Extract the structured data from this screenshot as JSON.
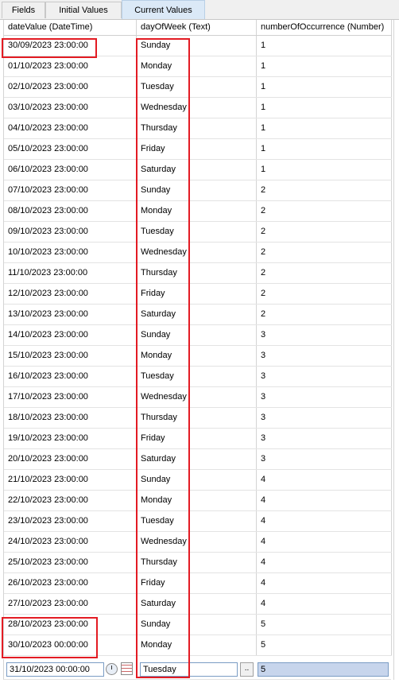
{
  "tabs": [
    "Fields",
    "Initial Values",
    "Current Values"
  ],
  "columns": [
    "dateValue  (DateTime)",
    "dayOfWeek  (Text)",
    "numberOfOccurrence  (Number)"
  ],
  "rows": [
    [
      "30/09/2023 23:00:00",
      "Sunday",
      "1"
    ],
    [
      "01/10/2023 23:00:00",
      "Monday",
      "1"
    ],
    [
      "02/10/2023 23:00:00",
      "Tuesday",
      "1"
    ],
    [
      "03/10/2023 23:00:00",
      "Wednesday",
      "1"
    ],
    [
      "04/10/2023 23:00:00",
      "Thursday",
      "1"
    ],
    [
      "05/10/2023 23:00:00",
      "Friday",
      "1"
    ],
    [
      "06/10/2023 23:00:00",
      "Saturday",
      "1"
    ],
    [
      "07/10/2023 23:00:00",
      "Sunday",
      "2"
    ],
    [
      "08/10/2023 23:00:00",
      "Monday",
      "2"
    ],
    [
      "09/10/2023 23:00:00",
      "Tuesday",
      "2"
    ],
    [
      "10/10/2023 23:00:00",
      "Wednesday",
      "2"
    ],
    [
      "11/10/2023 23:00:00",
      "Thursday",
      "2"
    ],
    [
      "12/10/2023 23:00:00",
      "Friday",
      "2"
    ],
    [
      "13/10/2023 23:00:00",
      "Saturday",
      "2"
    ],
    [
      "14/10/2023 23:00:00",
      "Sunday",
      "3"
    ],
    [
      "15/10/2023 23:00:00",
      "Monday",
      "3"
    ],
    [
      "16/10/2023 23:00:00",
      "Tuesday",
      "3"
    ],
    [
      "17/10/2023 23:00:00",
      "Wednesday",
      "3"
    ],
    [
      "18/10/2023 23:00:00",
      "Thursday",
      "3"
    ],
    [
      "19/10/2023 23:00:00",
      "Friday",
      "3"
    ],
    [
      "20/10/2023 23:00:00",
      "Saturday",
      "3"
    ],
    [
      "21/10/2023 23:00:00",
      "Sunday",
      "4"
    ],
    [
      "22/10/2023 23:00:00",
      "Monday",
      "4"
    ],
    [
      "23/10/2023 23:00:00",
      "Tuesday",
      "4"
    ],
    [
      "24/10/2023 23:00:00",
      "Wednesday",
      "4"
    ],
    [
      "25/10/2023 23:00:00",
      "Thursday",
      "4"
    ],
    [
      "26/10/2023 23:00:00",
      "Friday",
      "4"
    ],
    [
      "27/10/2023 23:00:00",
      "Saturday",
      "4"
    ],
    [
      "28/10/2023 23:00:00",
      "Sunday",
      "5"
    ],
    [
      "30/10/2023 00:00:00",
      "Monday",
      "5"
    ]
  ],
  "edit_row": {
    "date_value": "31/10/2023 00:00:00",
    "day_value": "Tuesday",
    "ellipsis_label": "..",
    "number_value": "5"
  },
  "colors": {
    "highlight": "#e31b23",
    "active_tab": "#dbe9f7",
    "selected_input": "#c7d5ec"
  },
  "icons": {
    "time_picker": "clock-icon",
    "date_picker": "calendar-icon"
  }
}
